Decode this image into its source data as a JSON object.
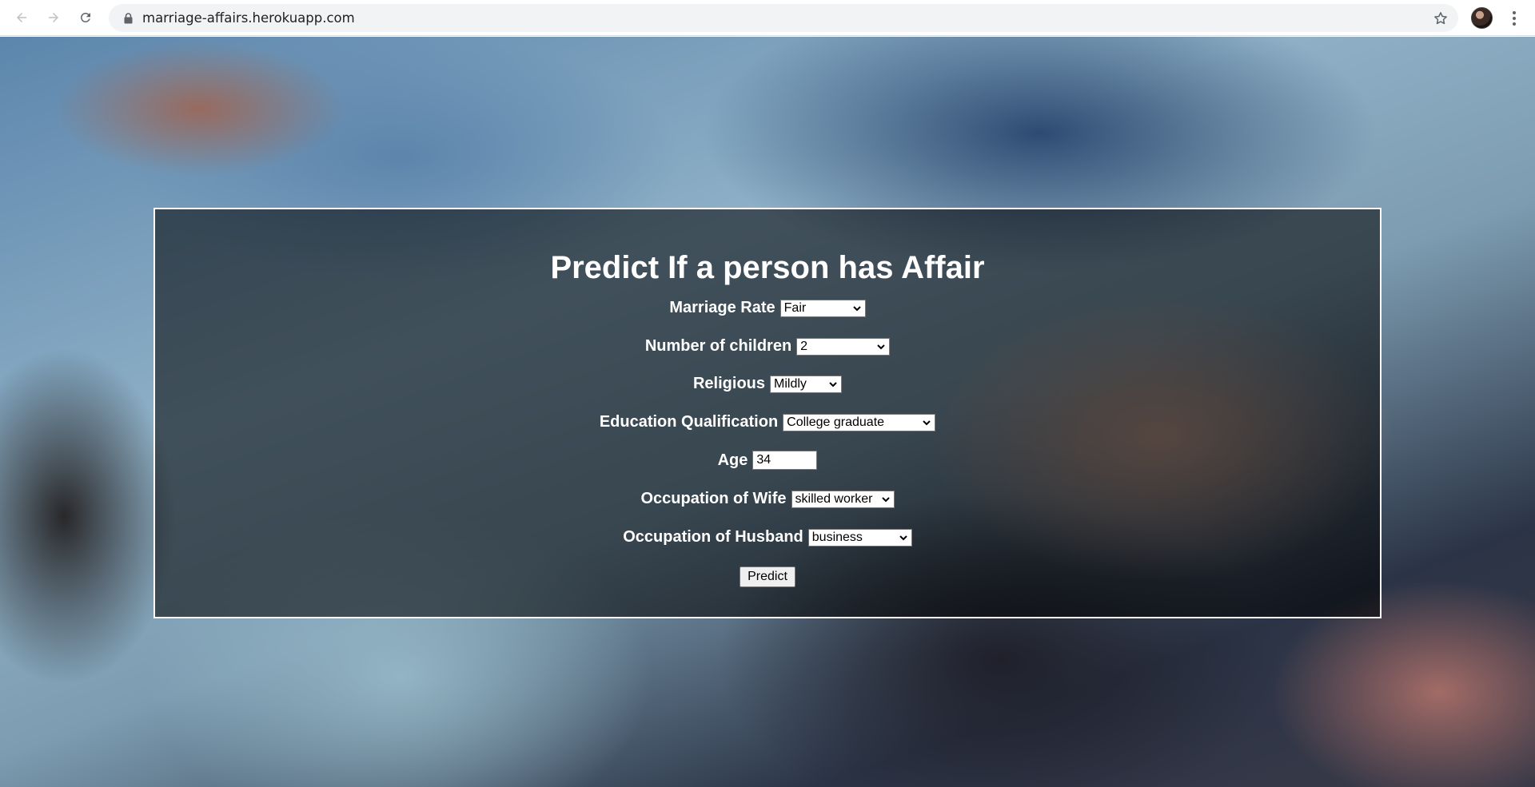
{
  "browser": {
    "url": "marriage-affairs.herokuapp.com",
    "icons": {
      "back": "arrow-left-icon",
      "forward": "arrow-right-icon",
      "reload": "reload-icon",
      "lock": "lock-icon",
      "bookmark": "star-icon",
      "menu": "kebab-menu-icon"
    }
  },
  "form": {
    "title": "Predict If a person has Affair",
    "fields": {
      "marriage_rate": {
        "label": "Marriage Rate",
        "value": "Fair"
      },
      "children": {
        "label": "Number of children",
        "value": "2"
      },
      "religious": {
        "label": "Religious",
        "value": "Mildly"
      },
      "education": {
        "label": "Education Qualification",
        "value": "College graduate"
      },
      "age": {
        "label": "Age",
        "value": "34"
      },
      "wife_occupation": {
        "label": "Occupation of Wife",
        "value": "skilled worker"
      },
      "husband_occupation": {
        "label": "Occupation of Husband",
        "value": "business"
      }
    },
    "submit_label": "Predict"
  },
  "colors": {
    "panel_border": "#ffffff",
    "label_text": "#ffffff"
  }
}
